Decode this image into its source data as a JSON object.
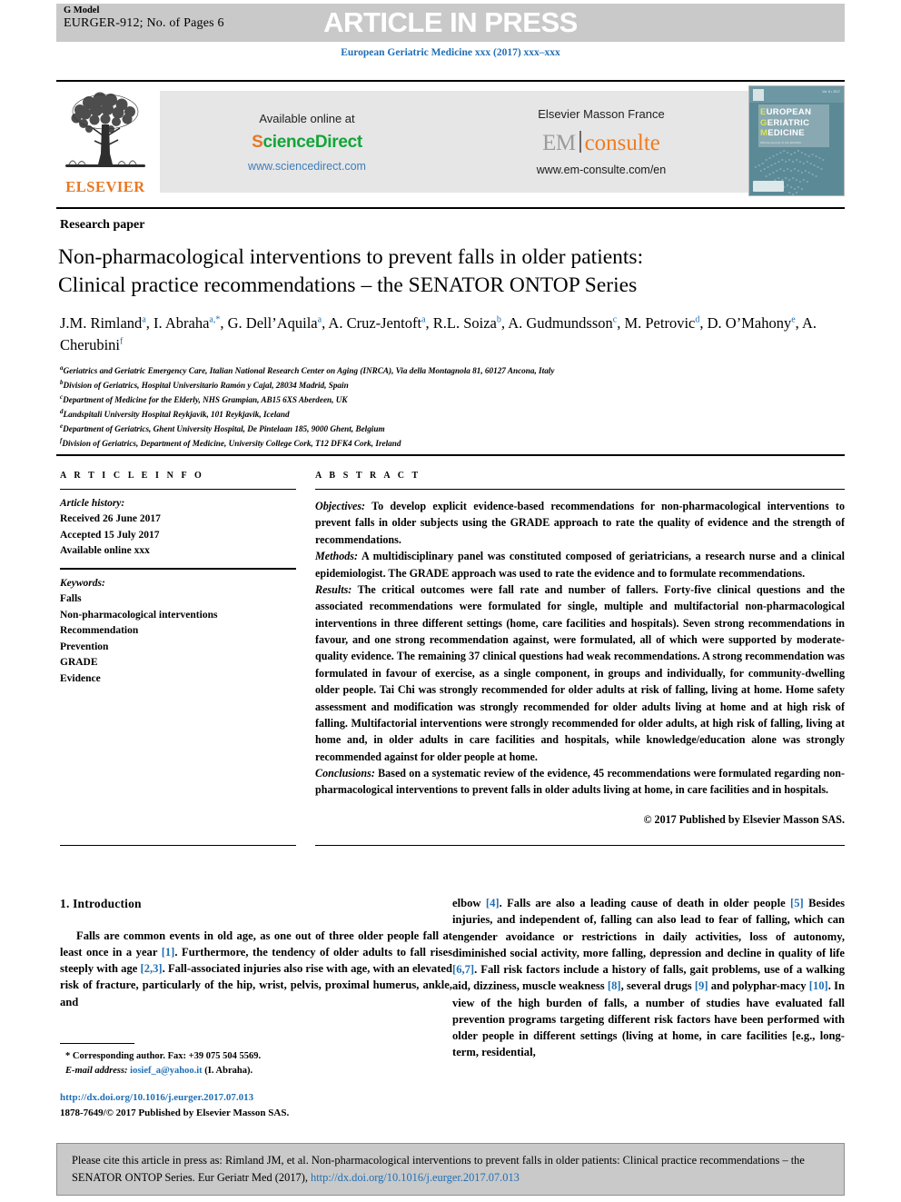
{
  "press_header": {
    "g_model_label": "G Model",
    "model_id": "EURGER-912; No. of Pages 6",
    "banner": "ARTICLE IN PRESS",
    "journal_line": "European Geriatric Medicine xxx (2017) xxx–xxx"
  },
  "masthead": {
    "publisher_logo_word": "ELSEVIER",
    "sciencedirect": {
      "available_label": "Available online at",
      "brand_first_letter": "S",
      "brand_rest": "cienceDirect",
      "url": "www.sciencedirect.com"
    },
    "emconsulte": {
      "publisher_label": "Elsevier Masson France",
      "brand_left": "EM",
      "brand_right": "consulte",
      "url": "www.em-consulte.com/en"
    },
    "cover": {
      "line1_cap": "E",
      "line1_rest": "UROPEAN",
      "line2_cap": "G",
      "line2_rest": "ERIATRIC",
      "line3_cap": "M",
      "line3_rest": "EDICINE",
      "subtitle": "Official journal of the EUGMS",
      "issue_note": "Vol. 8 • 2017"
    }
  },
  "article": {
    "kicker": "Research paper",
    "title_line1": "Non-pharmacological interventions to prevent falls in older patients:",
    "title_line2": "Clinical practice recommendations – the SENATOR ONTOP Series",
    "authors": [
      {
        "name": "J.M. Rimland",
        "sup": "a",
        "sep": ","
      },
      {
        "name": "I. Abraha",
        "sup": "a,*",
        "sep": ","
      },
      {
        "name": "G. Dell’Aquila",
        "sup": "a",
        "sep": ","
      },
      {
        "name": "A. Cruz-Jentoft",
        "sup": "a",
        "sep": ","
      },
      {
        "name": "R.L. Soiza",
        "sup": "b",
        "sep": ","
      },
      {
        "name": "A. Gudmundsson",
        "sup": "c",
        "sep": ","
      },
      {
        "name": "M. Petrovic",
        "sup": "d",
        "sep": ","
      },
      {
        "name": "D. O’Mahony",
        "sup": "e",
        "sep": ","
      },
      {
        "name": "A. Cherubini",
        "sup": "f",
        "sep": ""
      }
    ],
    "affiliations": [
      {
        "mark": "a",
        "text": "Geriatrics and Geriatric Emergency Care, Italian National Research Center on Aging (INRCA), Via della Montagnola 81, 60127 Ancona, Italy"
      },
      {
        "mark": "b",
        "text": "Division of Geriatrics, Hospital Universitario Ramón y Cajal, 28034 Madrid, Spain"
      },
      {
        "mark": "c",
        "text": "Department of Medicine for the Elderly, NHS Grampian, AB15 6XS Aberdeen, UK"
      },
      {
        "mark": "d",
        "text": "Landspitali University Hospital Reykjavik, 101 Reykjavik, Iceland"
      },
      {
        "mark": "e",
        "text": "Department of Geriatrics, Ghent University Hospital, De Pintelaan 185, 9000 Ghent, Belgium"
      },
      {
        "mark": "f",
        "text": "Division of Geriatrics, Department of Medicine, University College Cork, T12 DFK4 Cork, Ireland"
      }
    ]
  },
  "article_info": {
    "heading": "A R T I C L E  I N F O",
    "history_label": "Article history:",
    "received": "Received 26 June 2017",
    "accepted": "Accepted 15 July 2017",
    "available": "Available online xxx",
    "keywords_label": "Keywords:",
    "keywords": [
      "Falls",
      "Non-pharmacological interventions",
      "Recommendation",
      "Prevention",
      "GRADE",
      "Evidence"
    ]
  },
  "abstract": {
    "heading": "A B S T R A C T",
    "objectives_label": "Objectives:",
    "objectives_text": " To develop explicit evidence-based recommendations for non-pharmacological interventions to prevent falls in older subjects using the GRADE approach to rate the quality of evidence and the strength of recommendations.",
    "methods_label": "Methods:",
    "methods_text": " A multidisciplinary panel was constituted composed of geriatricians, a research nurse and a clinical epidemiologist. The GRADE approach was used to rate the evidence and to formulate recommendations.",
    "results_label": "Results:",
    "results_text": " The critical outcomes were fall rate and number of fallers. Forty-five clinical questions and the associated recommendations were formulated for single, multiple and multifactorial non-pharmacological interventions in three different settings (home, care facilities and hospitals). Seven strong recommendations in favour, and one strong recommendation against, were formulated, all of which were supported by moderate-quality evidence. The remaining 37 clinical questions had weak recommendations. A strong recommendation was formulated in favour of exercise, as a single component, in groups and individually, for community-dwelling older people. Tai Chi was strongly recommended for older adults at risk of falling, living at home. Home safety assessment and modification was strongly recommended for older adults living at home and at high risk of falling. Multifactorial interventions were strongly recommended for older adults, at high risk of falling, living at home and, in older adults in care facilities and hospitals, while knowledge/education alone was strongly recommended against for older people at home.",
    "conclusions_label": "Conclusions:",
    "conclusions_text": " Based on a systematic review of the evidence, 45 recommendations were formulated regarding non-pharmacological interventions to prevent falls in older adults living at home, in care facilities and in hospitals.",
    "copyright": "© 2017 Published by Elsevier Masson SAS."
  },
  "introduction": {
    "heading": "1. Introduction",
    "left_segments": [
      {
        "t": "Falls are common events in old age, as one out of three older people fall at least once in a year ",
        "k": "txt"
      },
      {
        "t": "[1]",
        "k": "ref"
      },
      {
        "t": ". Furthermore, the tendency of older adults to fall rises steeply with age ",
        "k": "txt"
      },
      {
        "t": "[2,3]",
        "k": "ref"
      },
      {
        "t": ". Fall-associated injuries also rise with age, with an elevated risk of fracture, particularly of the hip, wrist, pelvis, proximal humerus, ankle, and",
        "k": "txt"
      }
    ],
    "right_segments": [
      {
        "t": "elbow ",
        "k": "txt"
      },
      {
        "t": "[4]",
        "k": "ref"
      },
      {
        "t": ". Falls are also a leading cause of death in older people ",
        "k": "txt"
      },
      {
        "t": "[5]",
        "k": "ref"
      },
      {
        "t": " Besides injuries, and independent of, falling can also lead to fear of falling, which can engender avoidance or restrictions in daily activities, loss of autonomy, diminished social activity, more falling, depression and decline in quality of life ",
        "k": "txt"
      },
      {
        "t": "[6,7]",
        "k": "ref"
      },
      {
        "t": ". Fall risk factors include a history of falls, gait problems, use of a walking aid, dizziness, muscle weakness ",
        "k": "txt"
      },
      {
        "t": "[8]",
        "k": "ref"
      },
      {
        "t": ", several drugs ",
        "k": "txt"
      },
      {
        "t": "[9]",
        "k": "ref"
      },
      {
        "t": " and polyphar-macy ",
        "k": "txt"
      },
      {
        "t": "[10]",
        "k": "ref"
      },
      {
        "t": ". In view of the high burden of falls, a number of studies have evaluated fall prevention programs targeting different risk factors have been performed with older people in different settings (living at home, in care facilities [e.g., long-term, residential,",
        "k": "txt"
      }
    ]
  },
  "footnote": {
    "corresponding": "* Corresponding author. Fax: +39 075 504 5569.",
    "email_label": "E-mail address:",
    "email": "iosief_a@yahoo.it",
    "email_owner": "(I. Abraha).",
    "doi_url": "http://dx.doi.org/10.1016/j.eurger.2017.07.013",
    "issn_line": "1878-7649/© 2017 Published by Elsevier Masson SAS."
  },
  "cite_box": {
    "text_before": "Please cite this article in press as: Rimland JM, et al. Non-pharmacological interventions to prevent falls in older patients: Clinical practice recommendations – the SENATOR ONTOP Series. Eur Geriatr Med (2017), ",
    "doi": "http://dx.doi.org/10.1016/j.eurger.2017.07.013"
  },
  "colors": {
    "band_gray": "#c9c9c9",
    "panel_gray": "#e6e6e6",
    "link_blue": "#1f6fb5",
    "elsevier_orange": "#e87722",
    "sciencedirect_green": "#13a538",
    "consulte_orange": "#f07d20",
    "cover_teal": "#5b8a96"
  }
}
